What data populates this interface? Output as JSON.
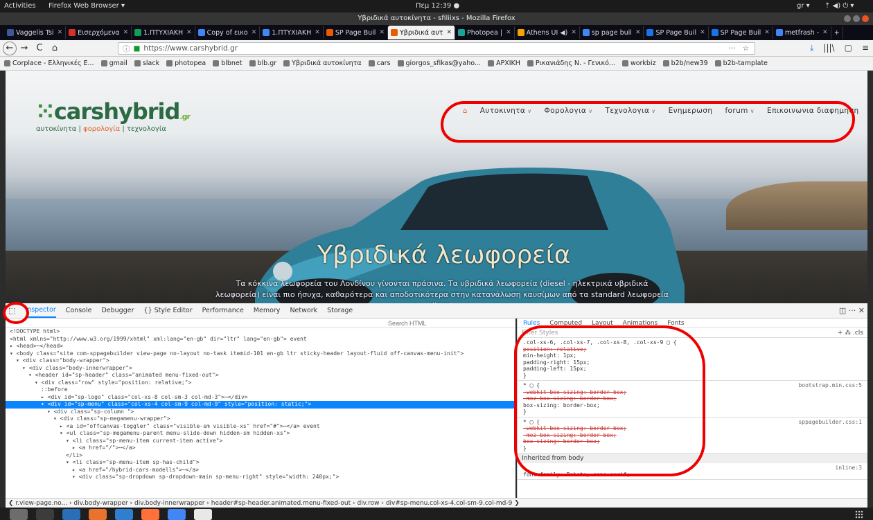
{
  "os": {
    "activities": "Activities",
    "app_menu": "Firefox Web Browser ▾",
    "clock": "Πεμ 12:39 ●",
    "locale": "gr ▾",
    "tray": "⇡ ◀) ⏻ ▾"
  },
  "window": {
    "title": "Υβριδικά αυτοκίνητα - sfiliixs - Mozilla Firefox"
  },
  "tabs": [
    {
      "label": "Vaggelis Tsi",
      "color": "#3b5998"
    },
    {
      "label": "Εισερχόμενα",
      "color": "#d93025"
    },
    {
      "label": "1.ΠΤΥΧΙΑΚΗ",
      "color": "#0f9d58"
    },
    {
      "label": "Copy of εικο",
      "color": "#4285f4"
    },
    {
      "label": "1.ΠΤΥΧΙΑΚΗ",
      "color": "#4285f4"
    },
    {
      "label": "SP Page Buil",
      "color": "#e65c00"
    },
    {
      "label": "Υβριδικά αυτ",
      "color": "#e65c00",
      "active": true
    },
    {
      "label": "Photopea |",
      "color": "#18a497"
    },
    {
      "label": "Athens UI ◀)",
      "color": "#f4a400"
    },
    {
      "label": "sp page buil",
      "color": "#4285f4"
    },
    {
      "label": "SP Page Buil",
      "color": "#1a73e8"
    },
    {
      "label": "SP Page Buil",
      "color": "#1a73e8"
    },
    {
      "label": "metfrash -",
      "color": "#4285f4"
    }
  ],
  "nav": {
    "url": "https://www.carshybrid.gr",
    "back": "←",
    "forward": "→",
    "reload": "C",
    "home": "⌂",
    "more": "···",
    "star": "☆",
    "download": "⤓",
    "library": "|||\\",
    "sidebar": "▢",
    "menu": "≡",
    "newtab": "+"
  },
  "bookmarks": [
    "Corplace - Ελληνικές Ε...",
    "gmail",
    "slack",
    "photopea",
    "blbnet",
    "blb.gr",
    "Υβριδικά αυτοκίνητα",
    "cars",
    "giorgos_sfikas@yaho...",
    "ΑΡΧΙΚΗ",
    "Ρικανιάδης Ν. - Γενικό...",
    "workbiz",
    "b2b/new39",
    "b2b-tamplate"
  ],
  "site": {
    "brand_main": "carshybrid",
    "brand_tld": ".gr",
    "tagline_a": "αυτοκίνητα",
    "sep1": "|",
    "tagline_b": "φορολογία",
    "sep2": "|",
    "tagline_c": "τεχνολογία",
    "home_icon": "⌂",
    "menu": [
      {
        "label": "Αυτοκινητα",
        "chev": "∨"
      },
      {
        "label": "Φορολογια",
        "chev": "∨"
      },
      {
        "label": "Τεχνολογια",
        "chev": "∨"
      },
      {
        "label": "Ενημερωση",
        "chev": ""
      },
      {
        "label": "forum",
        "chev": "∨"
      },
      {
        "label": "Επικοινωνια διαφημηση",
        "chev": ""
      }
    ],
    "hero_title": "Υβριδικά λεωφορεία",
    "hero_text": "Τα κόκκινα λεωφορεία του Λονδίνου γίνονται πράσινα. Τα υβριδικά λεωφορεία (diesel - ηλεκτρικά υβριδικά λεωφορεία) είναι πιο ήσυχα, καθαρότερα και αποδοτικότερα στην κατανάλωση καυσίμων από τα standard λεωφορεία diesel."
  },
  "devtools": {
    "tabs": [
      "Inspector",
      "Console",
      "Debugger",
      "{} Style Editor",
      "Performance",
      "Memory",
      "Network",
      "Storage"
    ],
    "search_placeholder": "Search HTML",
    "rule_tabs": [
      "Rules",
      "Computed",
      "Layout",
      "Animations",
      "Fonts"
    ],
    "filter_placeholder": "Filter Styles",
    "filter_actions": "+ ⁂ .cls",
    "right_actions": "◫ ··· ✕",
    "markup_lines": [
      {
        "indent": 0,
        "text": "<!DOCTYPE html>"
      },
      {
        "indent": 0,
        "text": "<html xmlns=\"http://www.w3.org/1999/xhtml\" xml:lang=\"en-gb\" dir=\"ltr\" lang=\"en-gb\"> event"
      },
      {
        "indent": 0,
        "text": "▸ <head>⋯</head>"
      },
      {
        "indent": 0,
        "text": "▾ <body class=\"site com-sppagebuilder view-page no-layout no-task itemid-101 en-gb ltr sticky-header layout-fluid off-canvas-menu-init\">"
      },
      {
        "indent": 1,
        "text": "▾ <div class=\"body-wrapper\">"
      },
      {
        "indent": 2,
        "text": "▾ <div class=\"body-innerwrapper\">"
      },
      {
        "indent": 3,
        "text": "▾ <header id=\"sp-header\" class=\"animated menu-fixed-out\">"
      },
      {
        "indent": 4,
        "text": "▾ <div class=\"row\" style=\"position: relative;\">"
      },
      {
        "indent": 5,
        "text": "::before"
      },
      {
        "indent": 5,
        "text": "▸ <div id=\"sp-logo\" class=\"col-xs-8 col-sm-3 col-md-3\">⋯</div>"
      },
      {
        "indent": 5,
        "text": "▾ <div id=\"sp-menu\" class=\"col-xs-4 col-sm-9 col-md-9\" style=\"position: static;\">",
        "selected": true
      },
      {
        "indent": 6,
        "text": "▾ <div class=\"sp-column \">"
      },
      {
        "indent": 7,
        "text": "▾ <div class=\"sp-megamenu-wrapper\">"
      },
      {
        "indent": 8,
        "text": "▸ <a id=\"offcanvas-toggler\" class=\"visible-sm visible-xs\" href=\"#\">⋯</a> event"
      },
      {
        "indent": 8,
        "text": "▾ <ul class=\"sp-megamenu-parent menu-slide-down hidden-sm hidden-xs\">"
      },
      {
        "indent": 9,
        "text": "▾ <li class=\"sp-menu-item current-item active\">"
      },
      {
        "indent": 10,
        "text": "▸ <a href=\"/\">⋯</a>"
      },
      {
        "indent": 9,
        "text": "</li>"
      },
      {
        "indent": 9,
        "text": "▾ <li class=\"sp-menu-item sp-has-child\">"
      },
      {
        "indent": 10,
        "text": "▸ <a href=\"/hybrid-cars-modells\">⋯</a>"
      },
      {
        "indent": 10,
        "text": "▾ <div class=\"sp-dropdown sp-dropdown-main sp-menu-right\" style=\"width: 240px;\">"
      }
    ],
    "rule_blocks": [
      {
        "src": "",
        "lines": [
          {
            "t": ".col-xs-6, .col-xs-7, .col-xs-8, .col-xs-9 ▢ {",
            "s": false
          },
          {
            "t": "  position: relative;",
            "s": true
          },
          {
            "t": "  min-height: 1px;",
            "s": false
          },
          {
            "t": "  padding-right: 15px;",
            "s": false
          },
          {
            "t": "  padding-left: 15px;",
            "s": false
          },
          {
            "t": "}",
            "s": false
          }
        ]
      },
      {
        "src": "bootstrap.min.css:5",
        "lines": [
          {
            "t": "* ▢ {",
            "s": false
          },
          {
            "t": "  -webkit-box-sizing: border-box;",
            "s": true
          },
          {
            "t": "  -moz-box-sizing: border-box;",
            "s": true
          },
          {
            "t": "  box-sizing: border-box;",
            "s": false
          },
          {
            "t": "}",
            "s": false
          }
        ]
      },
      {
        "src": "sppagebuilder.css:1",
        "lines": [
          {
            "t": "* ▢ {",
            "s": false
          },
          {
            "t": "  -webkit-box-sizing: border-box;",
            "s": true
          },
          {
            "t": "  -moz-box-sizing: border-box;",
            "s": true
          },
          {
            "t": "  box-sizing: border-box;",
            "s": true
          },
          {
            "t": "}",
            "s": false
          }
        ]
      }
    ],
    "inherited_label": "Inherited from body",
    "inherited_src": "inline:3",
    "inherited_line": "  font-family: Roboto, sans-serif;",
    "breadcrumbs": "❮  r.view-page.no...  ›  div.body-wrapper  ›  div.body-innerwrapper  ›  header#sp-header.animated.menu-fixed-out  ›  div.row  ›  div#sp-menu.col-xs-4.col-sm-9.col-md-9  ❯"
  },
  "dock_apps": [
    {
      "name": "files",
      "color": "#6d6d6d"
    },
    {
      "name": "app2",
      "color": "#3c3c3c"
    },
    {
      "name": "writer",
      "color": "#2a6fb5"
    },
    {
      "name": "software-center",
      "color": "#e9732d"
    },
    {
      "name": "help",
      "color": "#2f7fd1"
    },
    {
      "name": "firefox",
      "color": "#ff7139"
    },
    {
      "name": "chrome",
      "color": "#4285f4"
    },
    {
      "name": "app8",
      "color": "#e8e8e8"
    }
  ]
}
